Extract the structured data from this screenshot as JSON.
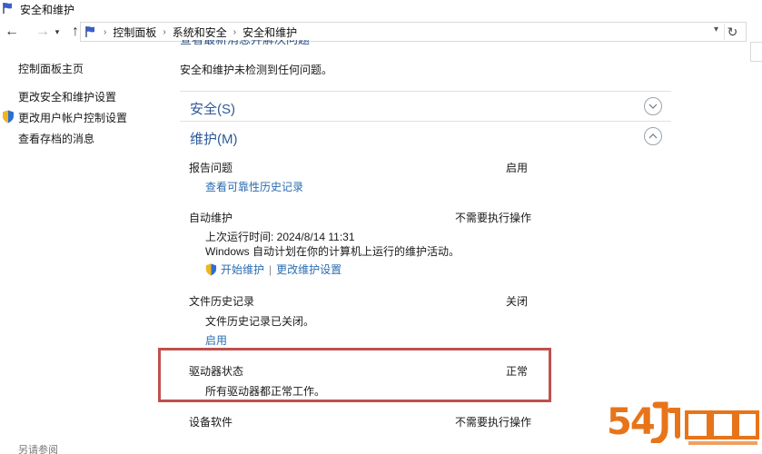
{
  "window": {
    "title": "安全和维护"
  },
  "navbar": {
    "breadcrumbs": [
      "控制面板",
      "系统和安全",
      "安全和维护"
    ]
  },
  "sidebar": {
    "items": [
      {
        "label": "控制面板主页"
      },
      {
        "label": "更改安全和维护设置"
      },
      {
        "label": "更改用户帐户控制设置"
      },
      {
        "label": "查看存档的消息"
      }
    ],
    "see_also": "另请参阅"
  },
  "main": {
    "cut_title": "查看最新消息并解决问题",
    "summary": "安全和维护未检测到任何问题。",
    "sections": [
      {
        "label": "安全(S)",
        "state": "collapsed"
      },
      {
        "label": "维护(M)",
        "state": "expanded"
      }
    ],
    "items": [
      {
        "title": "报告问题",
        "status": "启用",
        "link": "查看可靠性历史记录"
      },
      {
        "title": "自动维护",
        "status": "不需要执行操作",
        "lines": [
          "上次运行时间: 2024/8/14 11:31",
          "Windows 自动计划在你的计算机上运行的维护活动。"
        ],
        "links": [
          "开始维护",
          "更改维护设置"
        ]
      },
      {
        "title": "文件历史记录",
        "status": "关闭",
        "lines": [
          "文件历史记录已关闭。"
        ],
        "link": "启用"
      },
      {
        "title": "驱动器状态",
        "status": "正常",
        "lines": [
          "所有驱动器都正常工作。"
        ]
      },
      {
        "title": "设备软件",
        "status": "不需要执行操作"
      }
    ]
  },
  "watermark": {
    "text": "54"
  },
  "colors": {
    "link": "#2b6cb0",
    "section": "#2c5a99",
    "highlight": "#c0504d",
    "watermark": "#e8741a"
  }
}
